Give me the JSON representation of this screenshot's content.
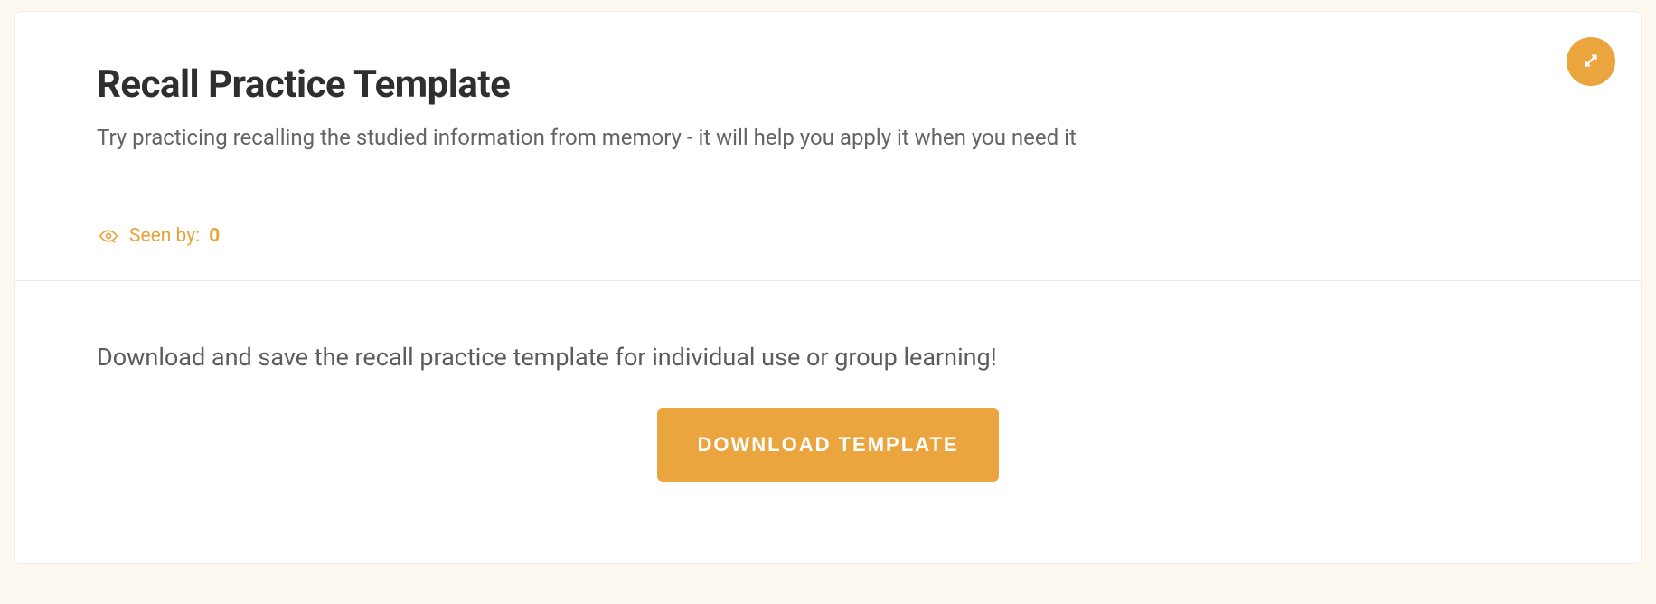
{
  "header": {
    "title": "Recall Practice Template",
    "subtitle": "Try practicing recalling the studied information from memory - it will help you apply it when you need it",
    "seen_by_label": "Seen by:",
    "seen_by_count": "0"
  },
  "body": {
    "description": "Download and save the recall practice template for individual use or group learning!",
    "download_label": "DOWNLOAD TEMPLATE"
  },
  "colors": {
    "accent": "#eba53e"
  }
}
